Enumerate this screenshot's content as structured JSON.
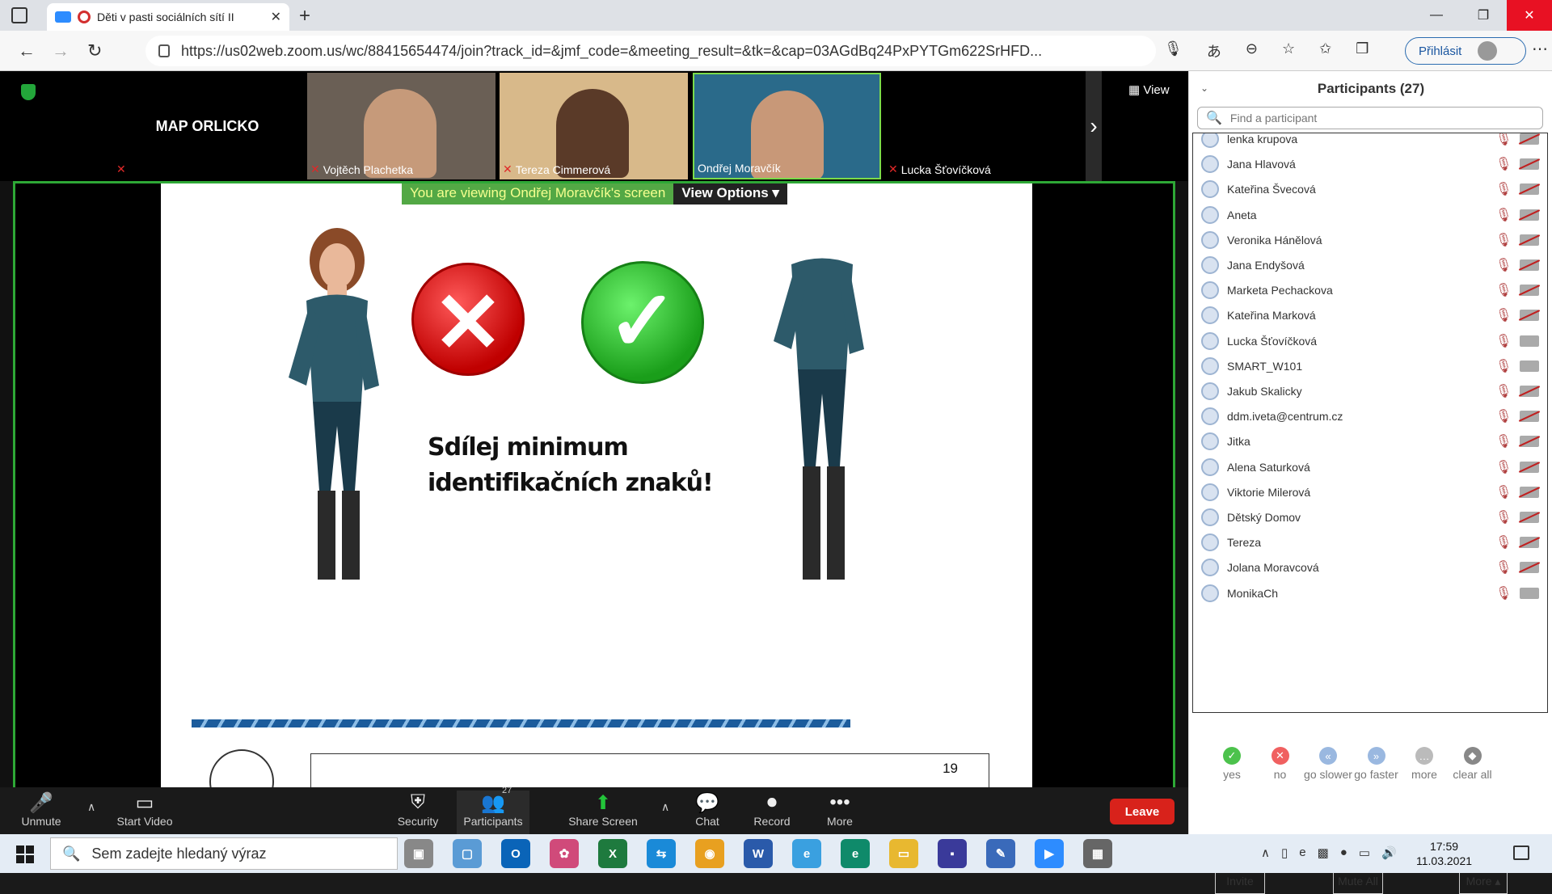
{
  "browser": {
    "tab_title": "Děti v pasti sociálních sítí II",
    "url": "https://us02web.zoom.us/wc/88415654474/join?track_id=&jmf_code=&meeting_result=&tk=&cap=03AGdBq24PxPYTGm622SrHFD...",
    "signin_label": "Přihlásit"
  },
  "strip": {
    "host_tile_label": "MAP ORLICKO",
    "tiles": [
      {
        "name": "Vojtěch Plachetka"
      },
      {
        "name": "Tereza Cimmerová"
      },
      {
        "name": "Ondřej Moravčík"
      },
      {
        "name": "Lucka Šťovíčková"
      }
    ],
    "view_label": "View"
  },
  "share": {
    "banner_text": "You are viewing Ondřej Moravčík's screen",
    "view_options_label": "View Options",
    "slide_line1": "Sdílej minimum",
    "slide_line2": "identifikačních znaků!",
    "page_number": "19"
  },
  "toolbar": {
    "unmute": "Unmute",
    "start_video": "Start Video",
    "security": "Security",
    "participants": "Participants",
    "participants_count": "27",
    "share_screen": "Share Screen",
    "chat": "Chat",
    "record": "Record",
    "more": "More",
    "leave": "Leave"
  },
  "panel": {
    "title": "Participants (27)",
    "search_placeholder": "Find a participant",
    "participants": [
      {
        "name": "lenka krupova",
        "cam_off": true
      },
      {
        "name": "Jana Hlavová",
        "cam_off": true
      },
      {
        "name": "Kateřina Švecová",
        "cam_off": true
      },
      {
        "name": "Aneta",
        "cam_off": true
      },
      {
        "name": "Veronika Hánělová",
        "cam_off": true
      },
      {
        "name": "Jana Endyšová",
        "cam_off": true
      },
      {
        "name": "Marketa Pechackova",
        "cam_off": true
      },
      {
        "name": "Kateřina Marková",
        "cam_off": true
      },
      {
        "name": "Lucka Šťovíčková",
        "cam_off": false
      },
      {
        "name": "SMART_W101",
        "cam_off": false
      },
      {
        "name": "Jakub Skalicky",
        "cam_off": true
      },
      {
        "name": "ddm.iveta@centrum.cz",
        "cam_off": true
      },
      {
        "name": "Jitka",
        "cam_off": true
      },
      {
        "name": "Alena Saturková",
        "cam_off": true
      },
      {
        "name": "Viktorie Milerová",
        "cam_off": true
      },
      {
        "name": "Dětský Domov",
        "cam_off": true
      },
      {
        "name": "Tereza",
        "cam_off": true
      },
      {
        "name": "Jolana Moravcová",
        "cam_off": true
      },
      {
        "name": "MonikaCh",
        "cam_off": false
      }
    ],
    "reactions": [
      "yes",
      "no",
      "go slower",
      "go faster",
      "more",
      "clear all"
    ],
    "invite": "Invite",
    "mute_all": "Mute All",
    "more": "More"
  },
  "taskbar": {
    "search_placeholder": "Sem zadejte hledaný výraz",
    "time": "17:59",
    "date": "11.03.2021"
  }
}
